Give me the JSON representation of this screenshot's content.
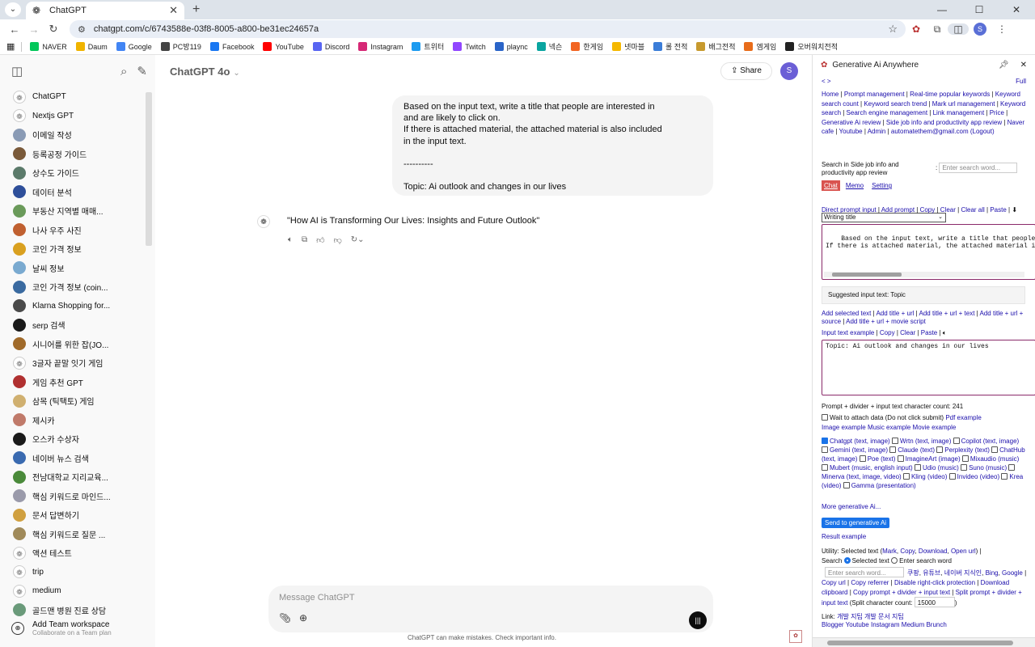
{
  "browser": {
    "tab_title": "ChatGPT",
    "url": "chatgpt.com/c/6743588e-03f8-8005-a800-be31ec24657a",
    "profile_initial": "S",
    "bookmarks": [
      {
        "label": "NAVER",
        "icon": "naver-icon",
        "color": "#03c75a"
      },
      {
        "label": "Daum",
        "icon": "daum-icon",
        "color": "#f0b400"
      },
      {
        "label": "Google",
        "icon": "google-icon",
        "color": "#4285f4"
      },
      {
        "label": "PC방119",
        "icon": "pc119-icon",
        "color": "#444444"
      },
      {
        "label": "Facebook",
        "icon": "facebook-icon",
        "color": "#1877f2"
      },
      {
        "label": "YouTube",
        "icon": "youtube-icon",
        "color": "#ff0000"
      },
      {
        "label": "Discord",
        "icon": "discord-icon",
        "color": "#5865f2"
      },
      {
        "label": "Instagram",
        "icon": "instagram-icon",
        "color": "#d62976"
      },
      {
        "label": "트위터",
        "icon": "twitter-icon",
        "color": "#1d9bf0"
      },
      {
        "label": "Twitch",
        "icon": "twitch-icon",
        "color": "#9146ff"
      },
      {
        "label": "plaync",
        "icon": "plaync-icon",
        "color": "#2a64c8"
      },
      {
        "label": "넥슨",
        "icon": "nexon-icon",
        "color": "#0aa5a0"
      },
      {
        "label": "한게임",
        "icon": "hangame-icon",
        "color": "#f26522"
      },
      {
        "label": "넷마블",
        "icon": "netmarble-icon",
        "color": "#f5b800"
      },
      {
        "label": "롤 전적",
        "icon": "lol-icon",
        "color": "#3b7dd8"
      },
      {
        "label": "배그전적",
        "icon": "pubg-icon",
        "color": "#c79a2e"
      },
      {
        "label": "엠게임",
        "icon": "mgame-icon",
        "color": "#e86c1a"
      },
      {
        "label": "오버워치전적",
        "icon": "overwatch-icon",
        "color": "#222222"
      }
    ]
  },
  "sidebar": {
    "items": [
      {
        "label": "ChatGPT",
        "color": "#ffffff"
      },
      {
        "label": "Nextjs GPT",
        "color": "#ffffff"
      },
      {
        "label": "이메일 작성",
        "color": "#8a9bb5"
      },
      {
        "label": "등록공정 가이드",
        "color": "#7a5a3a"
      },
      {
        "label": "상수도 가이드",
        "color": "#5b7a6a"
      },
      {
        "label": "데이터 분석",
        "color": "#2e4f9a"
      },
      {
        "label": "부동산 지역별 매매...",
        "color": "#6a9a5a"
      },
      {
        "label": "나사 우주 사진",
        "color": "#c06030"
      },
      {
        "label": "코인 가격 정보",
        "color": "#d9a020"
      },
      {
        "label": "날씨 정보",
        "color": "#7aaad0"
      },
      {
        "label": "코인 가격 정보 (coin...",
        "color": "#3a6aa0"
      },
      {
        "label": "Klarna Shopping for...",
        "color": "#4a4a4a"
      },
      {
        "label": "serp 검색",
        "color": "#1a1a1a"
      },
      {
        "label": "시니어를 위한 잡(JO...",
        "color": "#a06a2a"
      },
      {
        "label": "3글자 끝말 잇기 게임",
        "color": "#ffffff"
      },
      {
        "label": "게임 추천 GPT",
        "color": "#b03030"
      },
      {
        "label": "삼목 (틱택토) 게임",
        "color": "#d0b070"
      },
      {
        "label": "제시카",
        "color": "#c07a6a"
      },
      {
        "label": "오스카 수상자",
        "color": "#1a1a1a"
      },
      {
        "label": "네이버 뉴스 검색",
        "color": "#3a6ab0"
      },
      {
        "label": "전남대학교 지리교육...",
        "color": "#4a8a3a"
      },
      {
        "label": "핵심 키워드로 마인드...",
        "color": "#9a9aaa"
      },
      {
        "label": "문서 답변하기",
        "color": "#d0a040"
      },
      {
        "label": "핵심 키워드로 질문 ...",
        "color": "#a08a5a"
      },
      {
        "label": "액션 테스트",
        "color": "#ffffff"
      },
      {
        "label": "trip",
        "color": "#ffffff"
      },
      {
        "label": "medium",
        "color": "#ffffff"
      },
      {
        "label": "골드맨 병원 진료 상담",
        "color": "#6a9a7a"
      }
    ],
    "team_title": "Add Team workspace",
    "team_sub": "Collaborate on a Team plan"
  },
  "main": {
    "model": "ChatGPT 4o",
    "share_label": "Share",
    "user_initial": "S",
    "user_message": [
      "Based on the input text, write a title that people are interested in",
      "and are likely to click on.",
      "If there is attached material, the attached material is also included",
      "in the input text.",
      "",
      "----------",
      "",
      "Topic: Ai outlook and changes in our lives"
    ],
    "assistant_message": "\"How AI is Transforming Our Lives: Insights and Future Outlook\"",
    "composer_placeholder": "Message ChatGPT",
    "disclaimer": "ChatGPT can make mistakes. Check important info."
  },
  "extension": {
    "title": "Generative Ai Anywhere",
    "nav_prev": "< >",
    "full": "Full",
    "links_block": [
      "Home",
      "Prompt management",
      "Real-time popular keywords",
      "Keyword search count",
      "Keyword search trend",
      "Mark url management",
      "Keyword search",
      "Search engine management",
      "Link management",
      "Price",
      "Generative Ai review",
      "Side job info and productivity app review",
      "Naver cafe",
      "Youtube",
      "Admin",
      "automatethem@gmail.com (Logout)"
    ],
    "search_label_1": "Search in Side job info and",
    "search_label_2": "productivity app review",
    "search_placeholder": "Enter search word...",
    "tabs": [
      "Chat",
      "Memo",
      "Setting"
    ],
    "prompt_select": "Writing title",
    "prompt_links": [
      "Direct prompt input",
      "Add prompt",
      "Copy",
      "Clear",
      "Clear all",
      "Paste"
    ],
    "prompt_text": "Based on the input text, write a title that people are interested in and are likely to click on.\nIf there is attached material, the attached material is also included in the input text.",
    "suggested": "Suggested input text: Topic",
    "add_links": [
      "Add selected text",
      "Add title + url",
      "Add title + url + text",
      "Add title + url + source",
      "Add title + url + movie script"
    ],
    "input_links": [
      "Input text example",
      "Copy",
      "Clear",
      "Paste"
    ],
    "input_text": "Topic: Ai outlook and changes in our lives",
    "char_count": "Prompt + divider + input text character count: 241",
    "wait_label": "Wait to attach data (Do not click submit)",
    "pdf_example": "Pdf example",
    "examples": [
      "Image example",
      "Music example",
      "Movie example"
    ],
    "services": [
      {
        "label": "Chatgpt (text, image)",
        "checked": true
      },
      {
        "label": "Wrtn (text, image)",
        "checked": false
      },
      {
        "label": "Copilot (text, image)",
        "checked": false
      },
      {
        "label": "Gemini (text, image)",
        "checked": false
      },
      {
        "label": "Claude (text)",
        "checked": false
      },
      {
        "label": "Perplexity (text)",
        "checked": false
      },
      {
        "label": "ChatHub (text, image)",
        "checked": false
      },
      {
        "label": "Poe (text)",
        "checked": false
      },
      {
        "label": "ImagineArt (image)",
        "checked": false
      },
      {
        "label": "Mixaudio (music)",
        "checked": false
      },
      {
        "label": "Mubert (music, english input)",
        "checked": false
      },
      {
        "label": "Udio (music)",
        "checked": false
      },
      {
        "label": "Suno (music)",
        "checked": false
      },
      {
        "label": "Minerva (text, image, video)",
        "checked": false
      },
      {
        "label": "Kling (video)",
        "checked": false
      },
      {
        "label": "Invideo (video)",
        "checked": false
      },
      {
        "label": "Krea (video)",
        "checked": false
      },
      {
        "label": "Gamma (presentation)",
        "checked": false
      }
    ],
    "more": "More generative Ai...",
    "send": "Send to generative Ai",
    "result_example": "Result example",
    "utility_label": "Utility: Selected text (",
    "utility_links": [
      "Mark",
      "Copy",
      "Download",
      "Open url"
    ],
    "search_word": "Search",
    "radio_selected": "Selected text",
    "radio_enter": "Enter search word",
    "search2_placeholder": "Enter search word...",
    "engines": [
      "쿠팡",
      "유튜브",
      "네이버 지식인",
      "Bing",
      "Google"
    ],
    "util2": [
      "Copy url",
      "Copy referrer",
      "Disable right-click protection",
      "Download clipboard",
      "Copy prompt + divider + input text",
      "Split prompt + divider + input text"
    ],
    "split_label": "(Split character count:",
    "split_value": "15000",
    "link_label": "Link:",
    "link_items": [
      "개발 지팁",
      "개발 문서",
      "지팁"
    ],
    "link_items2": [
      "Blogger",
      "Youtube",
      "Instagram",
      "Medium",
      "Brunch"
    ]
  }
}
